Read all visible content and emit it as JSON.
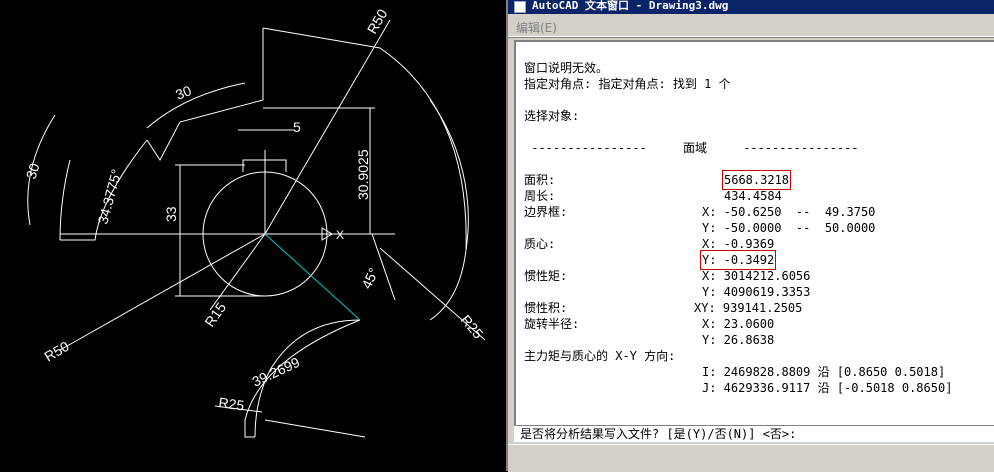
{
  "drawing": {
    "dims": {
      "r50_top": "R50",
      "arc30_upper": "30",
      "arc30_left": "30",
      "angle_left": "34.3775°",
      "dim_33": "33",
      "dim_5": "5",
      "dim_309025": "30.9025",
      "r15": "R15",
      "angle_45": "45°",
      "r25_right": "R25",
      "r50_bottom": "R50",
      "arc392699": "39.2699",
      "r25_bottom": "R25"
    }
  },
  "text_window": {
    "title": "AutoCAD 文本窗口 - Drawing3.dwg",
    "menu_edit": "编辑(E)",
    "lines": {
      "l1": "窗口说明无效。",
      "l2": "指定对角点: 指定对角点: 找到 1 个",
      "l3": "选择对象:",
      "l4": " ----------------     面域     ----------------",
      "area_label": "面积:",
      "area_value": "5668.3218",
      "perim_label": "周长:",
      "perim_value": "434.4584",
      "bbox_label": "边界框:",
      "bbox_x": "X: -50.6250  --  49.3750",
      "bbox_y": "Y: -50.0000  --  50.0000",
      "centroid_label": "质心:",
      "centroid_x": "X: -0.9369",
      "centroid_y": "Y: -0.3492",
      "moi_label": "惯性矩:",
      "moi_x": "X: 3014212.6056",
      "moi_y": "Y: 4090619.3353",
      "poi_label": "惯性积:",
      "poi_xy": "XY: 939141.2505",
      "rg_label": "旋转半径:",
      "rg_x": "X: 23.0600",
      "rg_y": "Y: 26.8638",
      "pm_label": "主力矩与质心的 X-Y 方向:",
      "pm_i": "I: 2469828.8809 沿 [0.8650 0.5018]",
      "pm_j": "J: 4629336.9117 沿 [-0.5018 0.8650]"
    },
    "prompt": "是否将分析结果写入文件? [是(Y)/否(N)] <否>:"
  }
}
